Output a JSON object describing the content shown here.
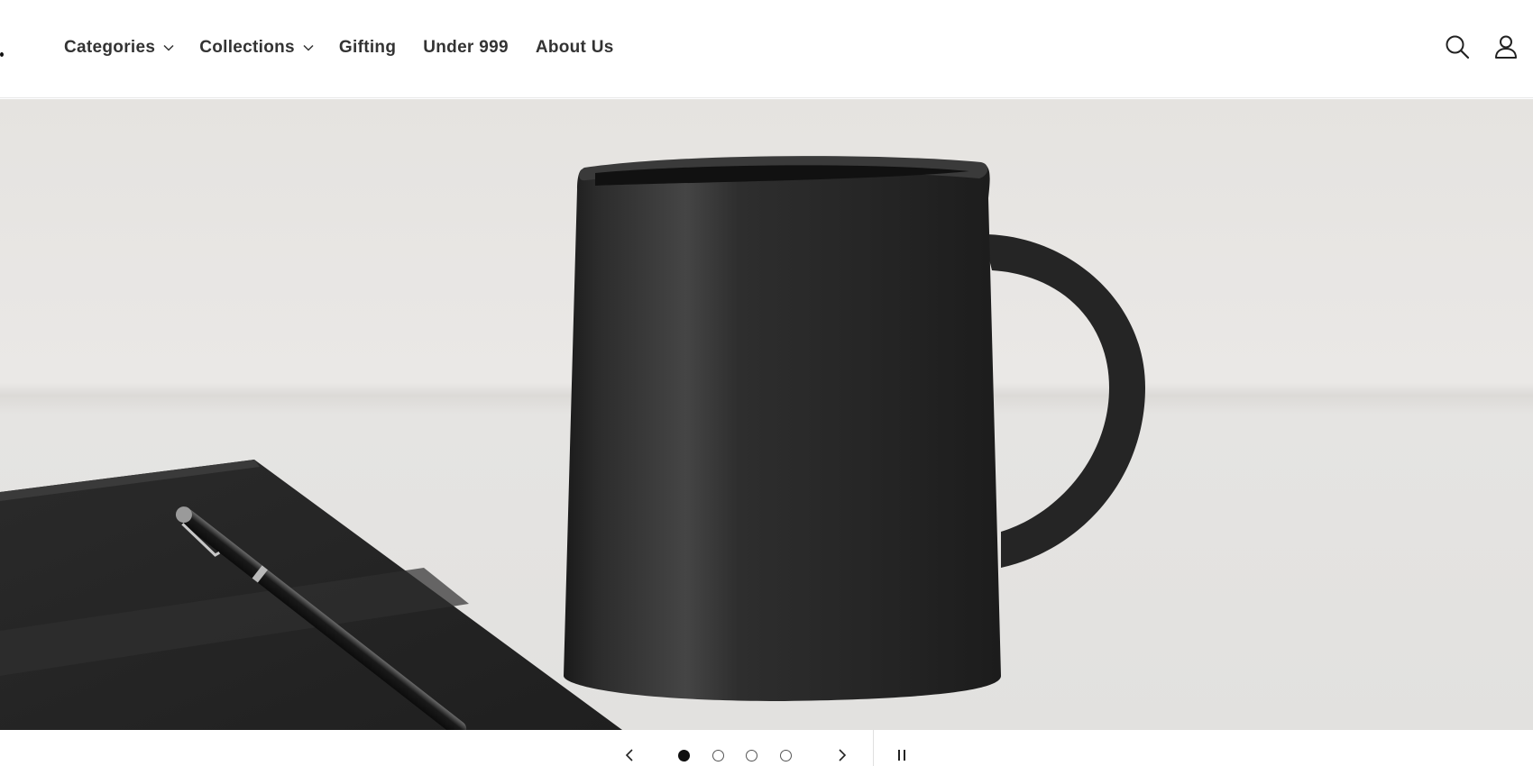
{
  "nav": {
    "items": [
      {
        "label": "Categories",
        "dropdown": true
      },
      {
        "label": "Collections",
        "dropdown": true
      },
      {
        "label": "Gifting",
        "dropdown": false
      },
      {
        "label": "Under 999",
        "dropdown": false
      },
      {
        "label": "About Us",
        "dropdown": false
      }
    ]
  },
  "header": {
    "icons": [
      "search-icon",
      "account-icon"
    ]
  },
  "hero": {
    "image": "black-ceramic-mug-with-notebook-and-pen",
    "colors": {
      "background": "#e6e4e1",
      "mug": "#2a2a2a",
      "notebook": "#262626"
    }
  },
  "slider": {
    "slide_count": 4,
    "active_slide": 1,
    "icons": [
      "chevron-left-icon",
      "chevron-right-icon",
      "pause-icon"
    ]
  }
}
